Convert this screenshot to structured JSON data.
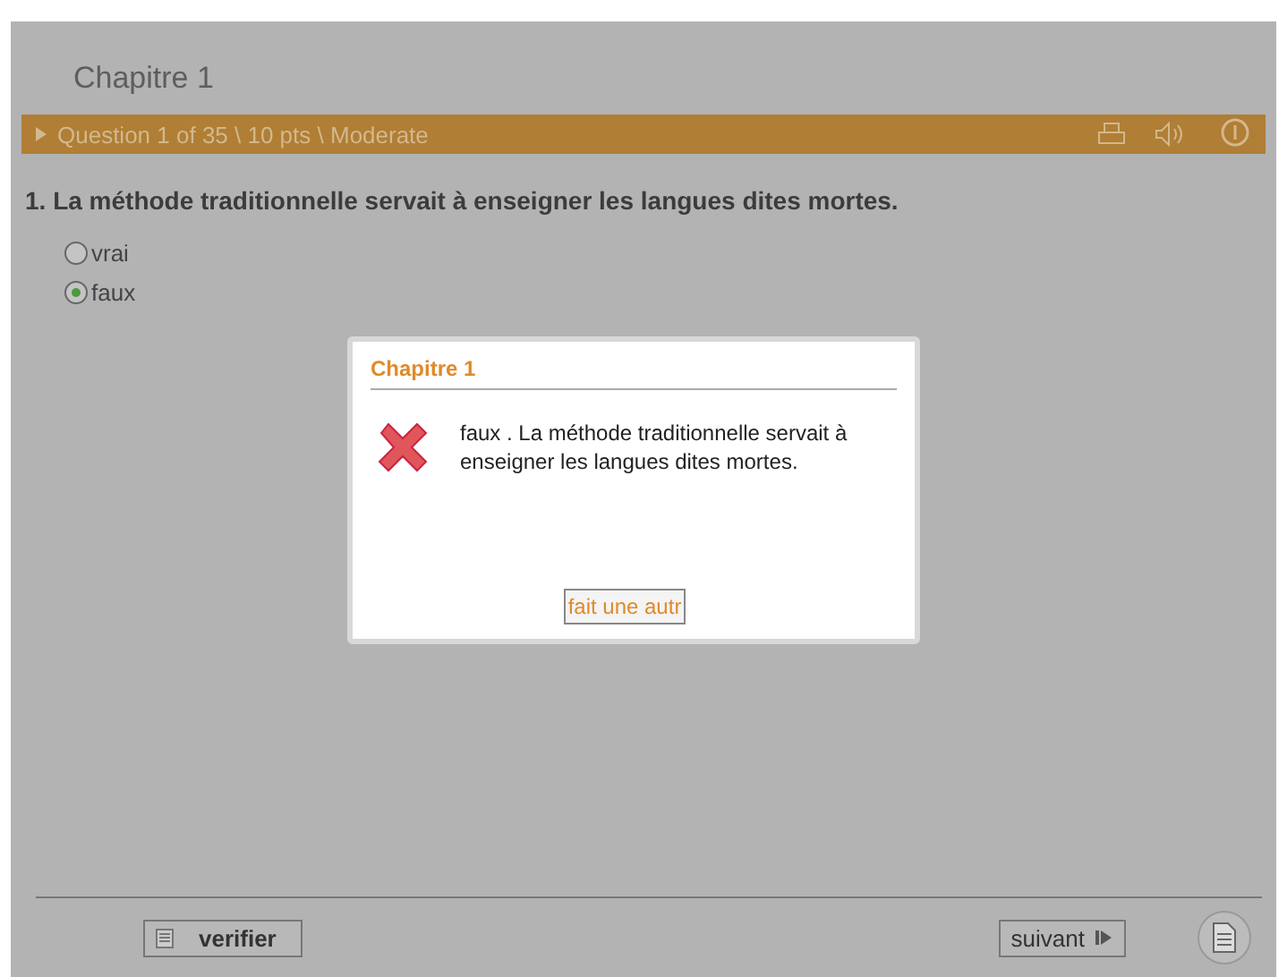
{
  "chapter_title": "Chapitre 1",
  "question_bar": {
    "text": "Question 1 of 35 \\ 10 pts \\ Moderate"
  },
  "question": {
    "text": "1.  La méthode traditionnelle servait à enseigner les langues dites mortes."
  },
  "options": [
    {
      "label": "vrai",
      "selected": false
    },
    {
      "label": "faux",
      "selected": true
    }
  ],
  "dialog": {
    "title": "Chapitre 1",
    "correct": false,
    "message": "faux . La méthode traditionnelle servait à enseigner les langues dites mortes.",
    "button": "fait une autr"
  },
  "footer": {
    "check_button": "verifier",
    "next_button": "suivant"
  }
}
